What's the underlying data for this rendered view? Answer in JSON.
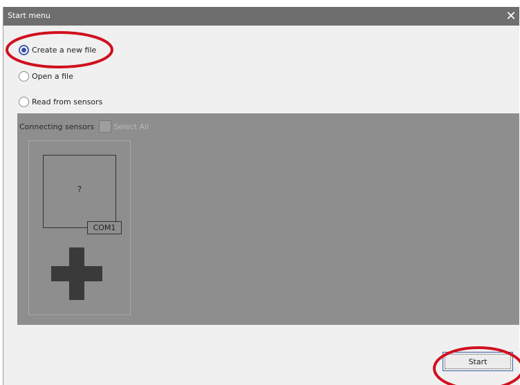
{
  "window": {
    "title": "Start menu",
    "close_glyph": "✕"
  },
  "options": [
    {
      "label": "Create a new file",
      "checked": true
    },
    {
      "label": "Open a file",
      "checked": false
    },
    {
      "label": "Read from sensors",
      "checked": false
    }
  ],
  "sensors": {
    "header_label": "Connecting sensors",
    "select_all_label": "Select All",
    "card": {
      "placeholder": "?",
      "port": "COM1"
    }
  },
  "actions": {
    "start_label": "Start"
  },
  "colors": {
    "titlebar": "#6e6e6e",
    "panel": "#8e8e8e",
    "radio_accent": "#3b4fa0",
    "annotation_red": "#d0101e"
  }
}
